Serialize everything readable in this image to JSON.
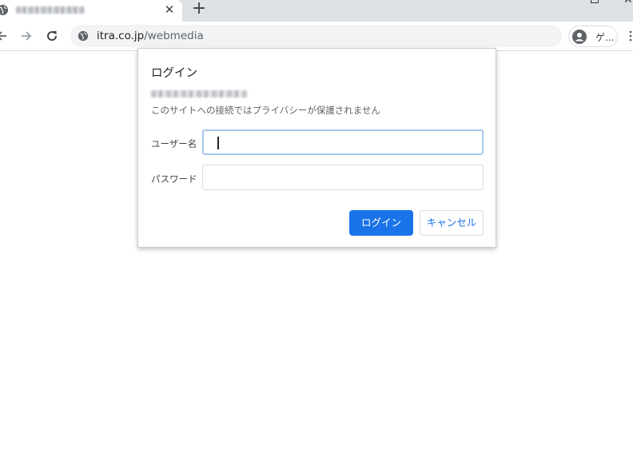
{
  "tab": {
    "title_obscured": true,
    "close_glyph": "✕",
    "favicon": "globe-icon"
  },
  "new_tab_glyph": "+",
  "toolbar": {
    "back_icon": "back-arrow-icon",
    "forward_icon": "forward-arrow-icon",
    "reload_icon": "reload-icon",
    "url_host": "itra.co.jp",
    "url_path": "/webmedia",
    "profile_label": "ゲ..."
  },
  "dialog": {
    "title": "ログイン",
    "origin_obscured": true,
    "privacy_notice": "このサイトへの接続ではプライバシーが保護されません",
    "username_label": "ユーザー名",
    "username_value": "",
    "password_label": "パスワード",
    "password_value": "",
    "login_button": "ログイン",
    "cancel_button": "キャンセル"
  },
  "colors": {
    "accent": "#1a73e8",
    "tabstrip": "#dee1e6",
    "omnibox": "#f1f3f4"
  }
}
